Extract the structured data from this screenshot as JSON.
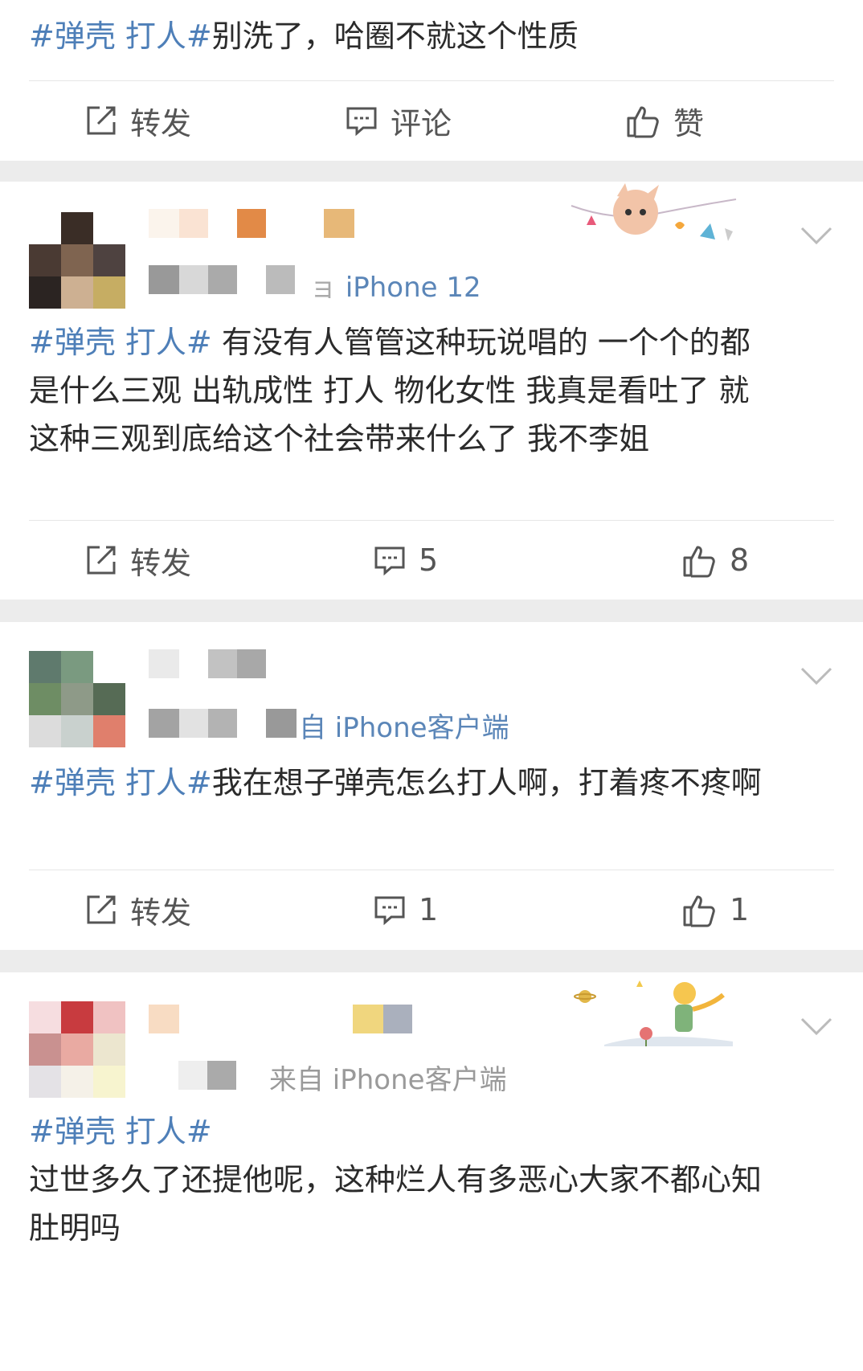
{
  "posts": [
    {
      "hashtag": "#弹壳 打人#",
      "body": "别洗了，哈圈不就这个性质",
      "actions": {
        "forward": "转发",
        "comment": "评论",
        "like": "赞"
      }
    },
    {
      "source": "iPhone 12",
      "source_prefix": "ョ",
      "hashtag": "#弹壳 打人#",
      "body": " 有没有人管管这种玩说唱的 一个个的都是什么三观 出轨成性 打人 物化女性 我真是看吐了 就这种三观到底给这个社会带来什么了 我不李姐",
      "actions": {
        "forward": "转发",
        "comment": "5",
        "like": "8"
      }
    },
    {
      "source": "自 iPhone客户端",
      "hashtag": "#弹壳 打人#",
      "body": "我在想子弹壳怎么打人啊，打着疼不疼啊",
      "actions": {
        "forward": "转发",
        "comment": "1",
        "like": "1"
      }
    },
    {
      "source": "来自 iPhone客户端",
      "hashtag": "#弹壳 打人#",
      "body": "过世多久了还提他呢，这种烂人有多恶心大家不都心知肚明吗"
    }
  ],
  "icons": {
    "forward": "share-icon",
    "comment": "comment-icon",
    "like": "thumbs-up-icon",
    "more": "chevron-down-icon"
  },
  "colors": {
    "hashtag": "#4e7fb8",
    "source": "#5b86b8",
    "text": "#2b2b2b",
    "separator": "#ececec"
  }
}
